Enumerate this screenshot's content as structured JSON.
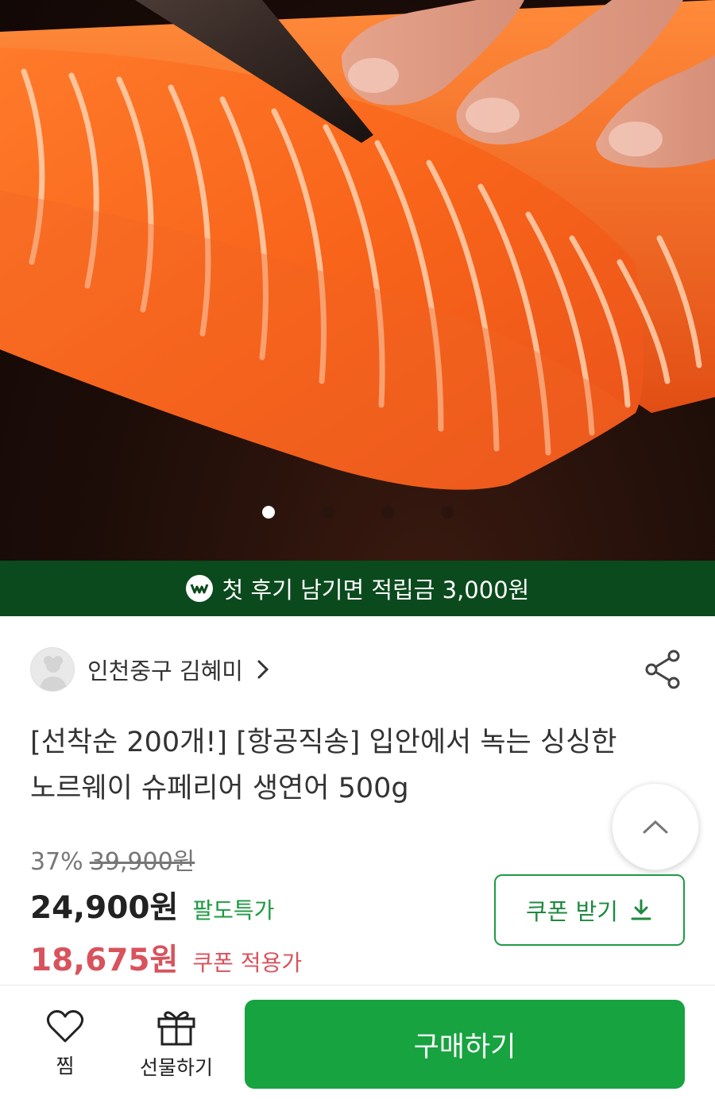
{
  "hero": {
    "image": "salmon-fillet-photo",
    "carousel": {
      "count": 4,
      "active_index": 0
    }
  },
  "promo_banner": {
    "icon": "w-badge-icon",
    "text": "첫 후기 남기면 적립금 3,000원"
  },
  "seller": {
    "name": "인천중구 김혜미",
    "avatar_icon": "chef-avatar-icon",
    "chevron_icon": "chevron-right-icon",
    "share_icon": "share-icon"
  },
  "product": {
    "title_line1": "[선착순 200개!] [항공직송] 입안에서 녹는 싱싱한",
    "title_line2": "노르웨이 슈페리어 생연어 500g",
    "discount_rate": "37%",
    "original_price": "39,900원",
    "price": "24,900원",
    "price_tag": "팔도특가",
    "coupon_price": "18,675원",
    "coupon_tag": "쿠폰 적용가"
  },
  "coupon_button": {
    "label": "쿠폰 받기",
    "icon": "download-icon"
  },
  "scroll_top_icon": "chevron-up-icon",
  "bottom_bar": {
    "wishlist_label": "찜",
    "wishlist_icon": "heart-icon",
    "gift_label": "선물하기",
    "gift_icon": "gift-icon",
    "buy_label": "구매하기"
  },
  "colors": {
    "promo_bg": "#0b4a1d",
    "accent_green": "#17a340",
    "coupon_red": "#d8535c"
  }
}
